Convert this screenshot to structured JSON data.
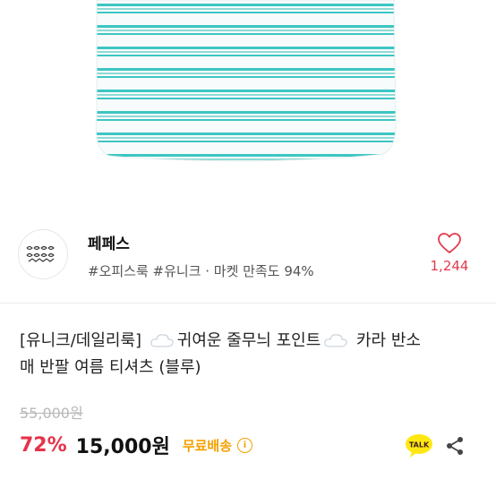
{
  "seller": {
    "name": "페페스",
    "tags": "#오피스룩 #유니크 · 마켓 만족도 94%",
    "likes": "1,244"
  },
  "product": {
    "title_part1": "[유니크/데일리룩]",
    "title_part2": "귀여운 줄무늬 포인트",
    "title_part3": "카라 반소",
    "title_part4": "매 반팔 여름 티셔츠 (블루)",
    "original_price": "55,000원",
    "discount": "72%",
    "price": "15,000원",
    "shipping": "무료배송"
  },
  "colors": {
    "accent_red": "#e6324b",
    "shipping_orange": "#f5a000",
    "stripe_teal": "#3cc6c3",
    "kakao_yellow": "#ffe812"
  },
  "icons": {
    "like": "heart-outline-icon",
    "info": "info-circle-icon",
    "talk": "kakao-talk-icon",
    "share": "share-icon",
    "title_emoji": "cloud-icon"
  }
}
